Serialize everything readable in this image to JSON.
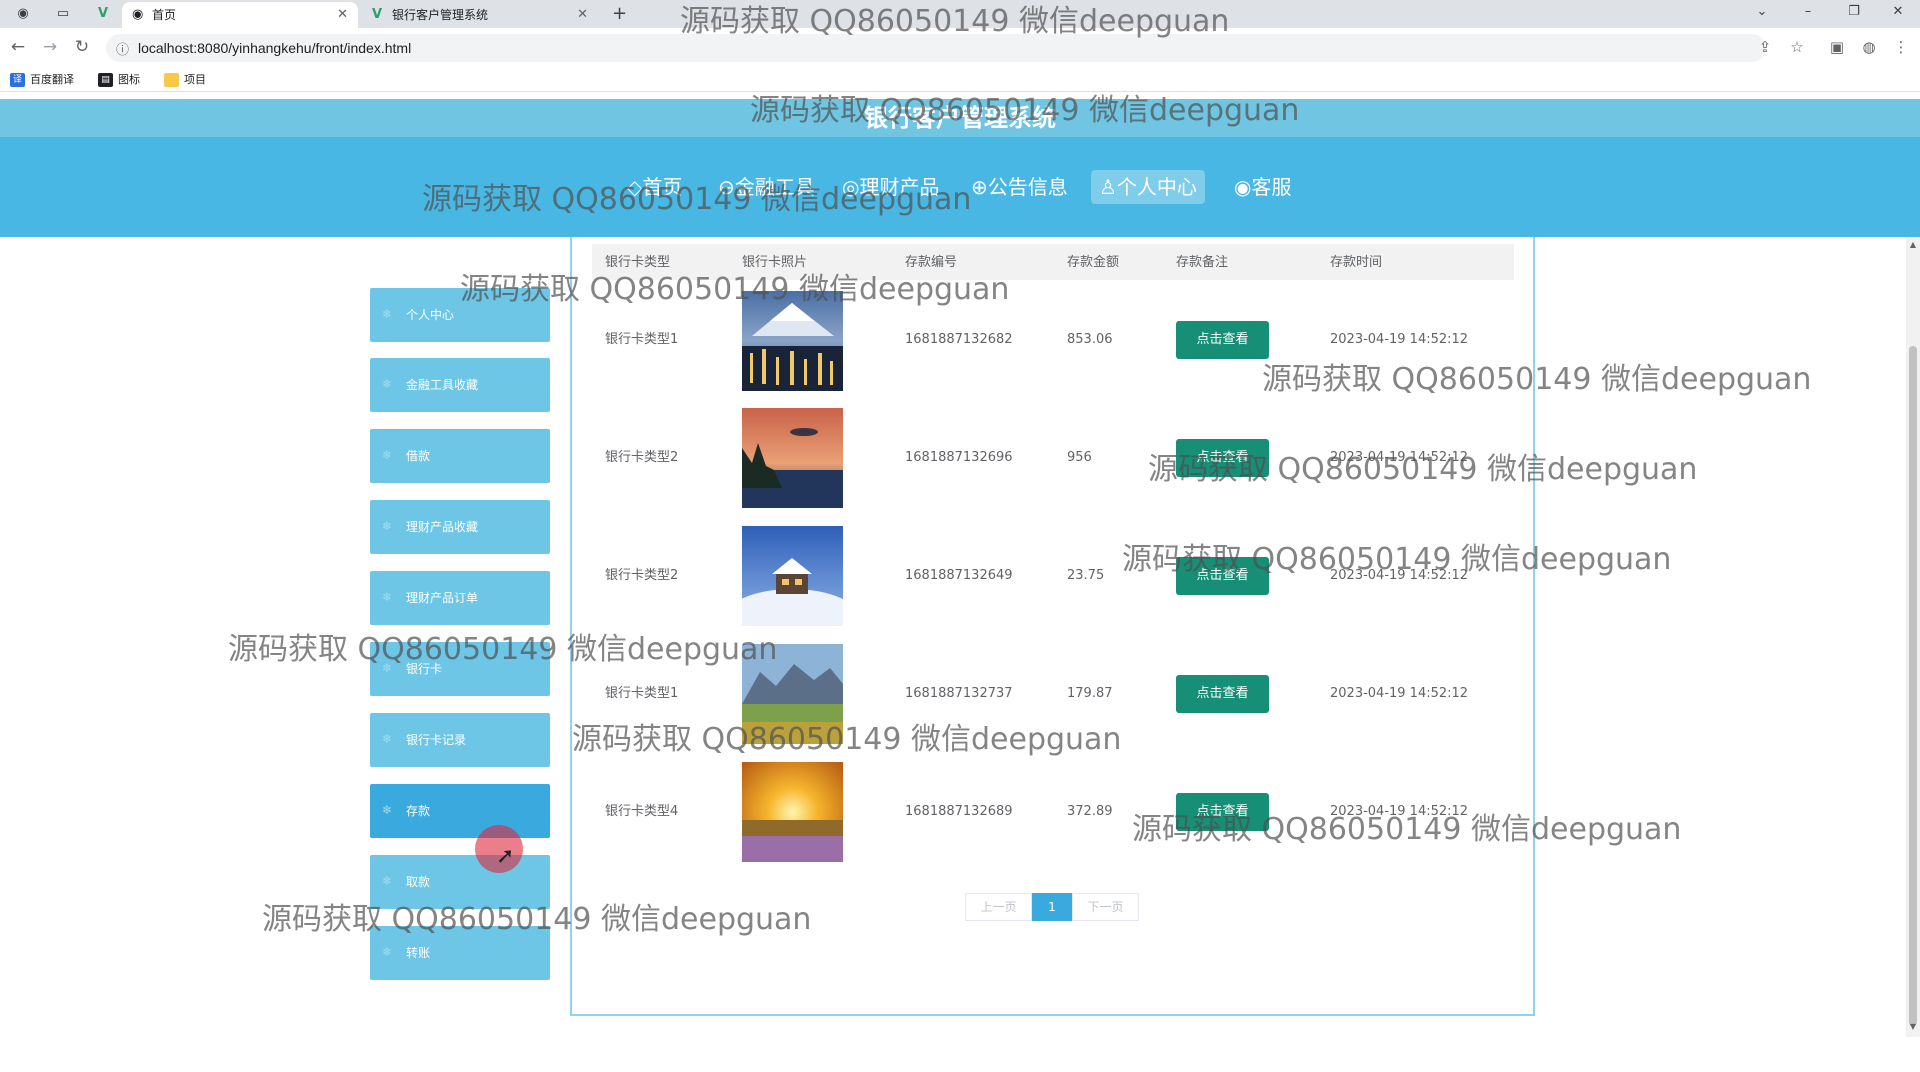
{
  "browser": {
    "tabs": [
      {
        "title": "首页",
        "close": "✕"
      },
      {
        "title": "银行客户管理系统",
        "close": "✕"
      }
    ],
    "new_tab": "+",
    "url": "localhost:8080/yinhangkehu/front/index.html",
    "bookmarks": [
      {
        "label": "百度翻译",
        "icon": "baidu-translate-icon"
      },
      {
        "label": "图标",
        "icon": "image-icon"
      },
      {
        "label": "项目",
        "icon": "folder-icon"
      }
    ]
  },
  "header": {
    "title": "银行客户管理系统",
    "nav": [
      {
        "label": "◇首页"
      },
      {
        "label": "⊖金融工具"
      },
      {
        "label": "◎理财产品"
      },
      {
        "label": "⊕公告信息"
      },
      {
        "label": "♙个人中心"
      },
      {
        "label": "◉客服"
      }
    ]
  },
  "sidebar": {
    "items": [
      {
        "label": "个人中心"
      },
      {
        "label": "金融工具收藏"
      },
      {
        "label": "借款"
      },
      {
        "label": "理财产品收藏"
      },
      {
        "label": "理财产品订单"
      },
      {
        "label": "银行卡"
      },
      {
        "label": "银行卡记录"
      },
      {
        "label": "存款"
      },
      {
        "label": "取款"
      },
      {
        "label": "转账"
      }
    ],
    "active": "存款"
  },
  "table": {
    "columns": [
      "银行卡类型",
      "银行卡照片",
      "存款编号",
      "存款金额",
      "存款备注",
      "存款时间"
    ],
    "button_label": "点击查看",
    "rows": [
      {
        "type": "银行卡类型1",
        "no": "1681887132682",
        "amount": "853.06",
        "time": "2023-04-19 14:52:12",
        "image": "city-mountain-night"
      },
      {
        "type": "银行卡类型2",
        "no": "1681887132696",
        "amount": "956",
        "time": "2023-04-19 14:52:12",
        "image": "lake-sunset"
      },
      {
        "type": "银行卡类型2",
        "no": "1681887132649",
        "amount": "23.75",
        "time": "2023-04-19 14:52:12",
        "image": "snow-cabin"
      },
      {
        "type": "银行卡类型1",
        "no": "1681887132737",
        "amount": "179.87",
        "time": "2023-04-19 14:52:12",
        "image": "mountain-meadow"
      },
      {
        "type": "银行卡类型4",
        "no": "1681887132689",
        "amount": "372.89",
        "time": "2023-04-19 14:52:12",
        "image": "sunrise-field"
      }
    ]
  },
  "pagination": {
    "prev": "上一页",
    "current": "1",
    "next": "下一页"
  },
  "watermark": "源码获取 QQ86050149 微信deepguan"
}
